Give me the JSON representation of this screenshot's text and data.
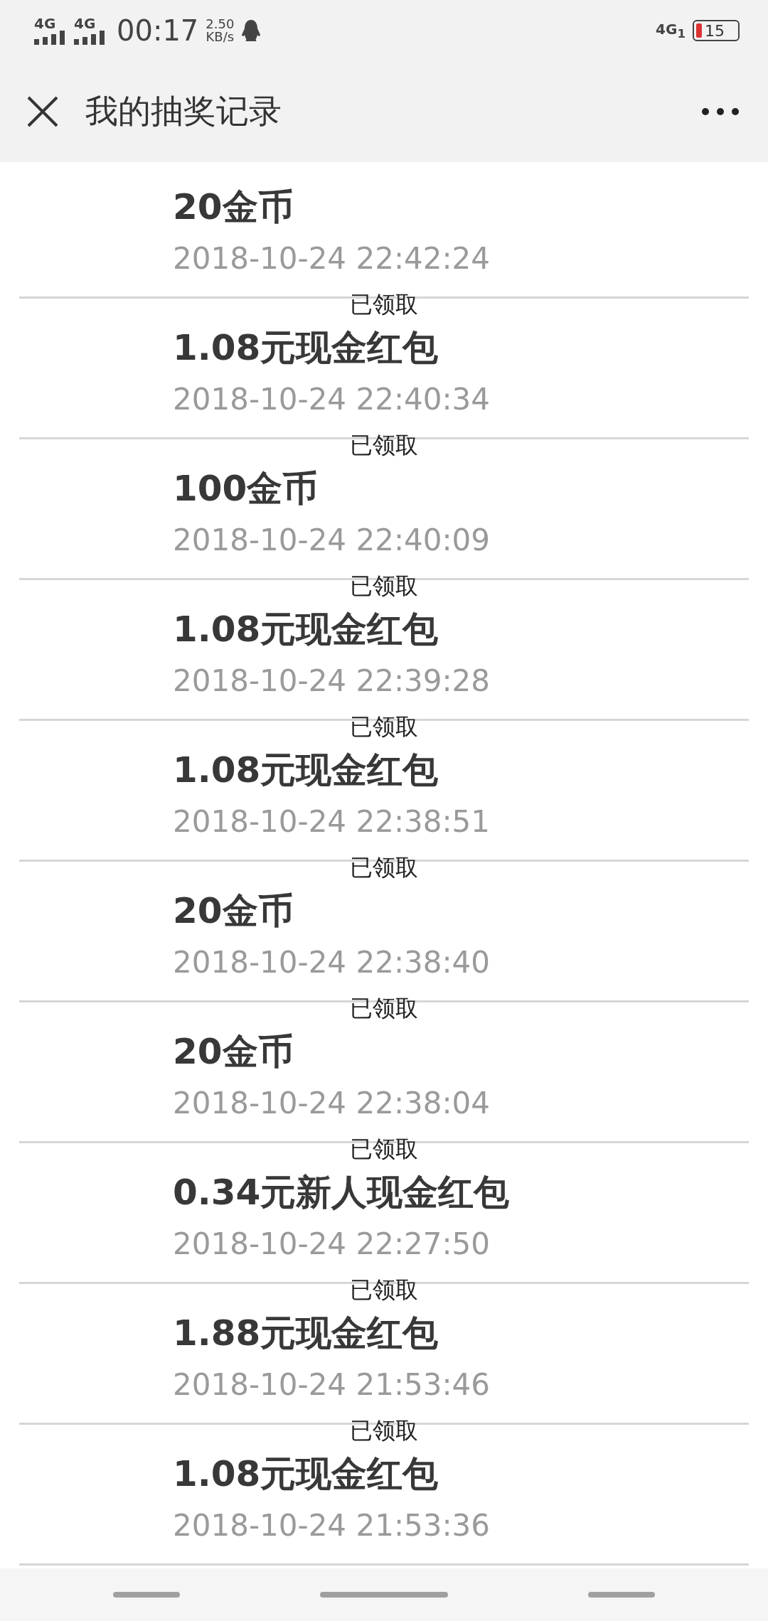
{
  "status_bar": {
    "signals": [
      {
        "label": "4G"
      },
      {
        "label": "4G"
      }
    ],
    "time": "00:17",
    "speed": {
      "value": "2.50",
      "unit": "KB/s"
    },
    "network": "4G$_{1}$",
    "battery": "15"
  },
  "header": {
    "title": "我的抽奖记录"
  },
  "records": [
    {
      "prize": "20金币",
      "time": "2018-10-24 22:42:24",
      "status": "已领取"
    },
    {
      "prize": "1.08元现金红包",
      "time": "2018-10-24 22:40:34",
      "status": "已领取"
    },
    {
      "prize": "100金币",
      "time": "2018-10-24 22:40:09",
      "status": "已领取"
    },
    {
      "prize": "1.08元现金红包",
      "time": "2018-10-24 22:39:28",
      "status": "已领取"
    },
    {
      "prize": "1.08元现金红包",
      "time": "2018-10-24 22:38:51",
      "status": "已领取"
    },
    {
      "prize": "20金币",
      "time": "2018-10-24 22:38:40",
      "status": "已领取"
    },
    {
      "prize": "20金币",
      "time": "2018-10-24 22:38:04",
      "status": "已领取"
    },
    {
      "prize": "0.34元新人现金红包",
      "time": "2018-10-24 22:27:50",
      "status": "已领取"
    },
    {
      "prize": "1.88元现金红包",
      "time": "2018-10-24 21:53:46",
      "status": "已领取"
    },
    {
      "prize": "1.08元现金红包",
      "time": "2018-10-24 21:53:36"
    }
  ]
}
